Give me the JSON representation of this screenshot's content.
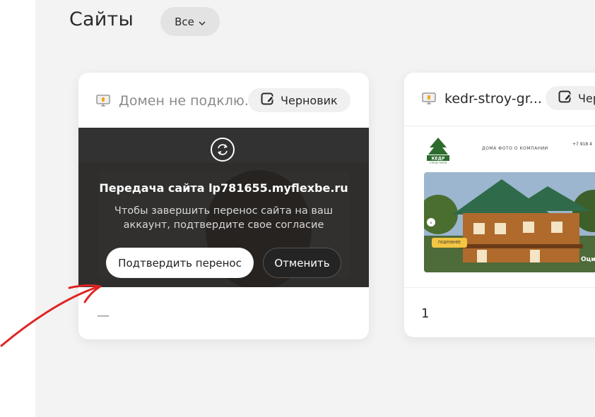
{
  "header": {
    "title": "Сайты",
    "filter_label": "Все"
  },
  "sites": [
    {
      "domain": "Домен не подклю...",
      "draft_label": "Черновик",
      "stat": "—",
      "transfer": {
        "title": "Передача сайта lp781655.myflexbe.ru",
        "text": "Чтобы завершить перенос сайта на ваш аккаунт, подтвердите свое согласие",
        "confirm_label": "Подтвердить перенос",
        "cancel_label": "Отменить"
      }
    },
    {
      "domain": "kedr-stroy-gr...",
      "draft_label": "Черновик",
      "stat": "1",
      "preview": {
        "logo_text": "КЕДР",
        "logo_subtext": "СТРОЙ ГРУПП",
        "nav": "ДОМА   ФОТО   О КОМПАНИИ",
        "phone": "+7 918 4",
        "more_label": "ПОДРОБНЕЕ",
        "caption": "Оци"
      }
    }
  ],
  "colors": {
    "annotation_arrow": "#e02424",
    "overlay": "#1c1c1c",
    "background": "#f3f3f3"
  }
}
